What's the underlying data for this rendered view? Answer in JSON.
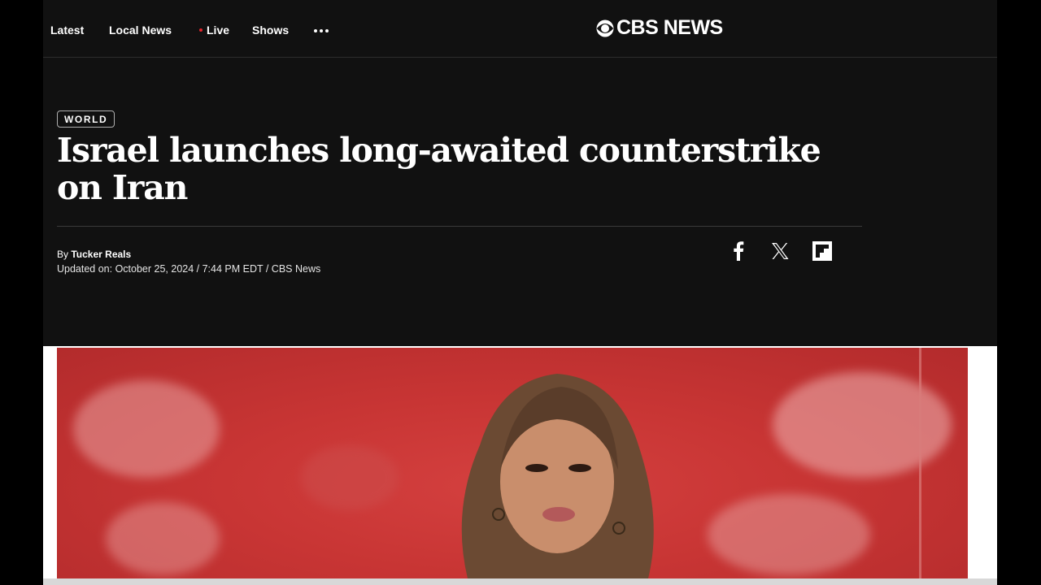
{
  "nav": {
    "items": [
      "Latest",
      "Local News",
      "Live",
      "Shows"
    ],
    "logo_text": "CBS NEWS"
  },
  "article": {
    "category": "WORLD",
    "headline_line1": "Israel launches long-awaited counterstrike",
    "headline_line2": "on Iran",
    "byline_prefix": "By",
    "author": "Tucker Reals",
    "updated": "Updated on: October 25, 2024 / 7:44 PM EDT / CBS News"
  },
  "share": {
    "icons": [
      "facebook-icon",
      "x-icon",
      "flipboard-icon"
    ]
  },
  "colors": {
    "background": "#111111",
    "live_dot": "#e3242b",
    "hero_red": "#c83534"
  }
}
